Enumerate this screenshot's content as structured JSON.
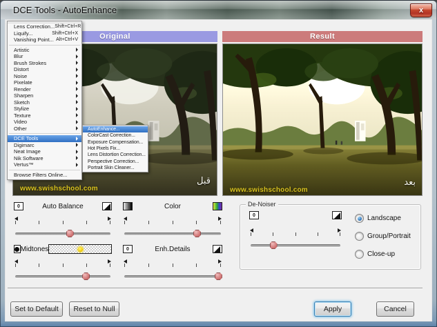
{
  "window": {
    "title": "DCE Tools - AutoEnhance"
  },
  "icons": {
    "close_glyph": "x",
    "zero_glyph": "0"
  },
  "menu": {
    "top_items": [
      {
        "label": "Lens Correction...",
        "shortcut": "Shift+Ctrl+R"
      },
      {
        "label": "Liquify...",
        "shortcut": "Shift+Ctrl+X"
      },
      {
        "label": "Vanishing Point...",
        "shortcut": "Alt+Ctrl+V"
      }
    ],
    "categories": [
      "Artistic",
      "Blur",
      "Brush Strokes",
      "Distort",
      "Noise",
      "Pixelate",
      "Render",
      "Sharpen",
      "Sketch",
      "Stylize",
      "Texture",
      "Video",
      "Other"
    ],
    "vendors": [
      {
        "label": "DCE Tools",
        "highlighted": true
      },
      {
        "label": "Digimarc",
        "highlighted": false
      },
      {
        "label": "Neat Image",
        "highlighted": false
      },
      {
        "label": "Nik Software",
        "highlighted": false
      },
      {
        "label": "Vertus™",
        "highlighted": false
      }
    ],
    "browse_item": "Browse Filters Online...",
    "submenu": {
      "items": [
        "AutoEnhance...",
        "ColorCast Correction...",
        "Exposure Compensation...",
        "Hot Pixels Fix...",
        "Lens Distortion Correction...",
        "Perspective Correction...",
        "Portrait Skin Cleaner..."
      ],
      "highlighted_index": 0
    }
  },
  "previews": {
    "original": {
      "header": "Original",
      "header_color": "#9a9ae2",
      "watermark": "www.swishschool.com",
      "corner_label": "قبل"
    },
    "result": {
      "header": "Result",
      "header_color": "#cc7b7b",
      "watermark": "www.swishschool.com",
      "corner_label": "بعد"
    }
  },
  "adjustments": {
    "auto_balance": {
      "label": "Auto Balance",
      "left_icon": "zero-icon",
      "right_icon": "contrast-icon",
      "value_pct": 57
    },
    "color": {
      "label": "Color",
      "left_icon": "grayscale-gradient-icon",
      "right_icon": "color-spectrum-icon",
      "value_pct": 75
    },
    "midtones": {
      "label": "Midtones",
      "left_icon": "dark-circle-icon",
      "right_icon": "sun-icon",
      "value_pct": 74
    },
    "enh_details": {
      "label": "Enh.Details",
      "left_icon": "zero-icon",
      "right_icon": "contrast-icon",
      "value_pct": 97
    }
  },
  "denoiser": {
    "title": "De-Noiser",
    "slider": {
      "left_icon": "zero-icon",
      "right_icon": "contrast-icon",
      "value_pct": 25
    },
    "options": [
      {
        "label": "Landscape",
        "selected": true
      },
      {
        "label": "Group/Portrait",
        "selected": false
      },
      {
        "label": "Close-up",
        "selected": false
      }
    ]
  },
  "buttons": {
    "set_default": "Set to Default",
    "reset_null": "Reset to Null",
    "apply": "Apply",
    "cancel": "Cancel"
  },
  "colors": {
    "menu_highlight": "#3b87d9",
    "original_header": "#9a9ae2",
    "result_header": "#cc7b7b"
  }
}
